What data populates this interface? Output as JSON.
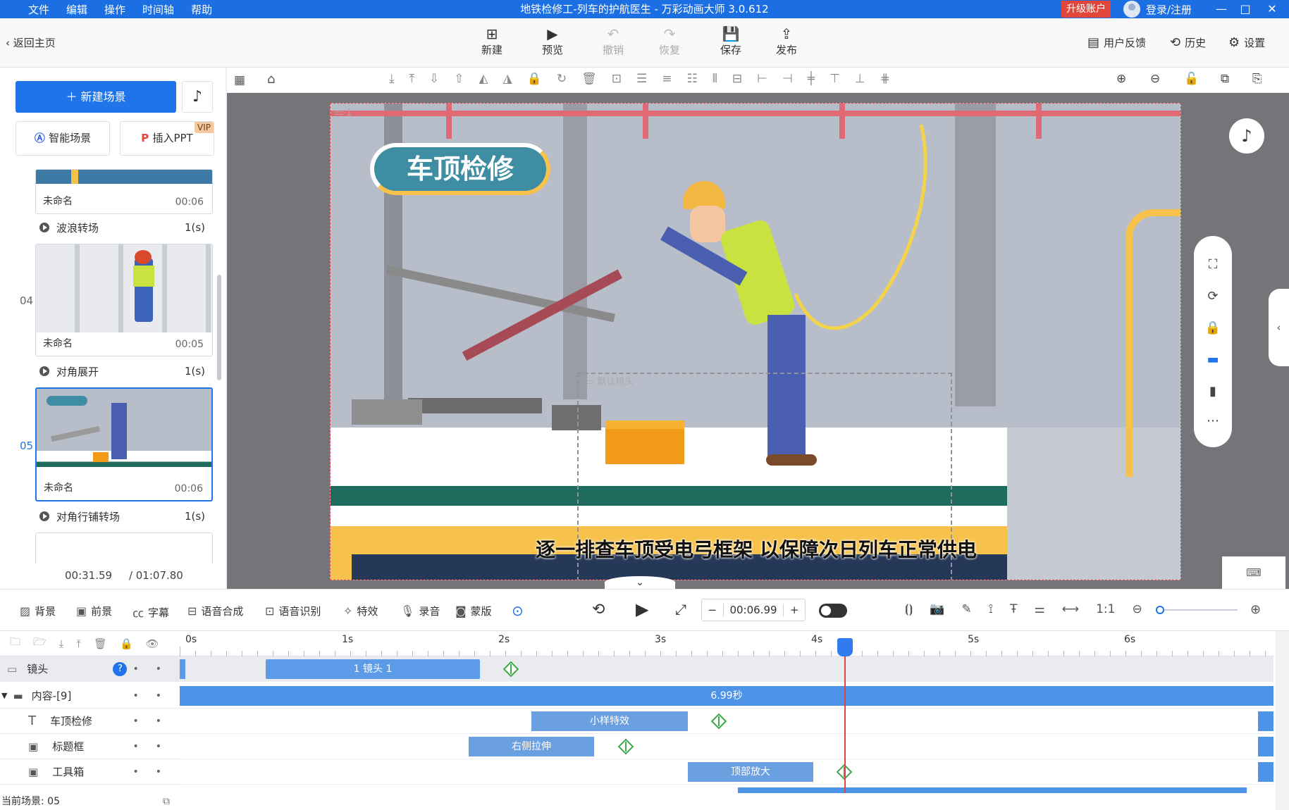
{
  "titlebar": {
    "menus": [
      "文件",
      "编辑",
      "操作",
      "时间轴",
      "帮助"
    ],
    "title": "地铁检修工-列车的护航医生 - 万彩动画大师 3.0.612",
    "upgrade": "升级账户",
    "login": "登录/注册"
  },
  "toolbar": {
    "back": "返回主页",
    "new": "新建",
    "preview": "预览",
    "undo": "撤销",
    "redo": "恢复",
    "save": "保存",
    "publish": "发布",
    "feedback": "用户反馈",
    "history": "历史",
    "settings": "设置"
  },
  "left": {
    "new_scene": "新建场景",
    "smart_scene": "智能场景",
    "insert_ppt": "插入PPT",
    "vip": "VIP",
    "cards": [
      {
        "num": "",
        "name": "未命名",
        "dur": "00:06"
      },
      {
        "num": "04",
        "name": "未命名",
        "dur": "00:05"
      },
      {
        "num": "05",
        "name": "未命名",
        "dur": "00:06"
      }
    ],
    "transitions": [
      {
        "name": "波浪转场",
        "dur": "1(s)"
      },
      {
        "name": "对角展开",
        "dur": "1(s)"
      },
      {
        "name": "对角行铺转场",
        "dur": "1(s)"
      }
    ],
    "time_current": "00:31.59",
    "time_total": "/ 01:07.80"
  },
  "stage": {
    "title_banner": "车顶检修",
    "subtitle": "逐一排查车顶受电弓框架 以保障次日列车正常供电",
    "camera_label": "默认镜头",
    "cam_num": "1"
  },
  "edit": {
    "items": [
      "背景",
      "前景",
      "字幕",
      "语音合成",
      "语音识别",
      "特效",
      "录音",
      "蒙版"
    ],
    "time": "00:06.99"
  },
  "timeline": {
    "ruler": [
      "0s",
      "1s",
      "2s",
      "3s",
      "4s",
      "5s",
      "6s"
    ],
    "rows": [
      {
        "name": "镜头"
      },
      {
        "name": "内容-[9]"
      },
      {
        "name": "车顶检修"
      },
      {
        "name": "标题框"
      },
      {
        "name": "工具箱"
      }
    ],
    "clips": {
      "camera": "1 镜头 1",
      "content": "6.99秒",
      "c1": "小样特效",
      "c2": "右侧拉伸",
      "c3": "顶部放大"
    },
    "status": "当前场景: 05"
  }
}
